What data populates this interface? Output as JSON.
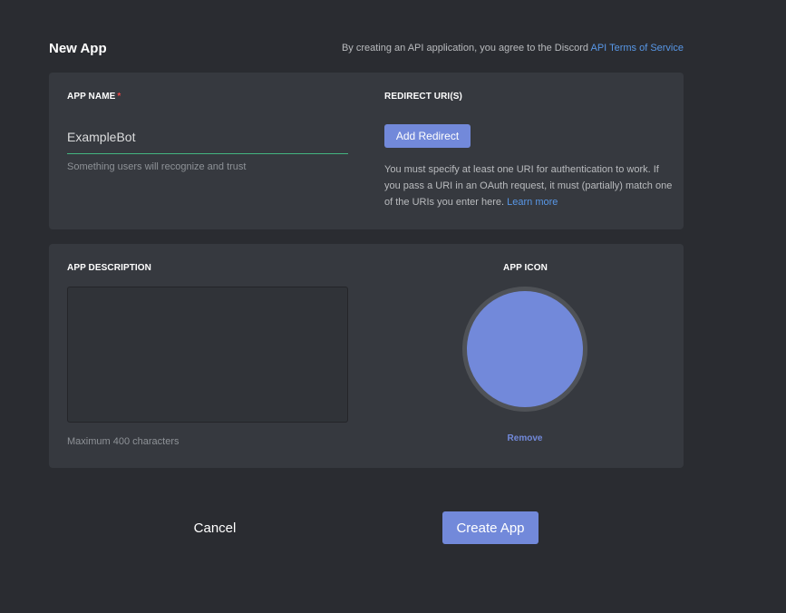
{
  "header": {
    "title": "New App",
    "tos_prefix": "By creating an API application, you agree to the Discord ",
    "tos_link": "API Terms of Service"
  },
  "app_name": {
    "label": "APP NAME",
    "required_marker": "*",
    "value": "ExampleBot",
    "hint": "Something users will recognize and trust"
  },
  "redirect": {
    "label": "REDIRECT URI(S)",
    "button": "Add Redirect",
    "help": "You must specify at least one URI for authentication to work. If you pass a URI in an OAuth request, it must (partially) match one of the URIs you enter here. ",
    "learn_more": "Learn more"
  },
  "description": {
    "label": "APP DESCRIPTION",
    "value": "",
    "hint": "Maximum 400 characters"
  },
  "icon": {
    "label": "APP ICON",
    "remove": "Remove",
    "color": "#7289da"
  },
  "footer": {
    "cancel": "Cancel",
    "create": "Create App"
  },
  "colors": {
    "background": "#2a2c31",
    "panel": "#36393f",
    "accent": "#7289da",
    "link": "#5897e6",
    "input_underline": "#43b581",
    "required": "#f04747"
  }
}
